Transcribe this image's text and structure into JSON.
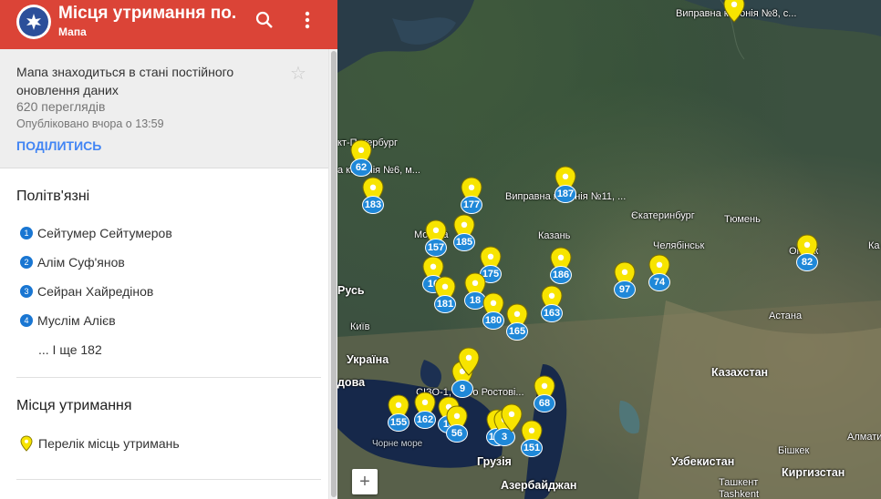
{
  "header": {
    "title": "Місця утримання по...",
    "subtitle": "Мапа"
  },
  "info": {
    "description": "Мапа знаходиться в стані постійного оновлення даних",
    "views": "620 переглядів",
    "published": "Опубліковано вчора о 13:59",
    "share_label": "ПОДІЛИТИСЬ"
  },
  "prisoners": {
    "title": "Політв'язні",
    "items": [
      {
        "num": "1",
        "name": "Сейтумер Сейтумеров"
      },
      {
        "num": "2",
        "name": "Алім Суф'янов"
      },
      {
        "num": "3",
        "name": "Сейран Хайредінов"
      },
      {
        "num": "4",
        "name": "Муслім Алієв"
      }
    ],
    "more": "... І ще 182"
  },
  "places": {
    "title": "Місця утримання",
    "item": "Перелік місць утримань"
  },
  "map": {
    "zoom_in": "+",
    "labels": [
      "Виправна колонія №8, с...",
      "кт-Петербург",
      "а колонія №6, м...",
      "Виправна колонія №11, ...",
      "Москва",
      "Казань",
      "Єкатеринбург",
      "Тюмень",
      "Челябінськ",
      "Омськ",
      "Астана",
      "Русь",
      "Київ",
      "Україна",
      "дова",
      "СІЗО-1, місто Ростові...",
      "Казахстан",
      "Чорне море",
      "Грузія",
      "Азербайджан",
      "Узбекистан",
      "Бішкек",
      "Алмати",
      "Ташкент",
      "Tashkent",
      "Киргизстан",
      "Ка"
    ],
    "pins": [
      {
        "count": "",
        "kind": "pin"
      },
      {
        "count": "62",
        "kind": "pin"
      },
      {
        "count": "183",
        "kind": "pin"
      },
      {
        "count": "177",
        "kind": "pin"
      },
      {
        "count": "187",
        "kind": "pin"
      },
      {
        "count": "157",
        "kind": "pin"
      },
      {
        "count": "185",
        "kind": "pin"
      },
      {
        "count": "175",
        "kind": "pin"
      },
      {
        "count": "186",
        "kind": "pin"
      },
      {
        "count": "97",
        "kind": "pin"
      },
      {
        "count": "74",
        "kind": "pin"
      },
      {
        "count": "82",
        "kind": "pin"
      },
      {
        "count": "16",
        "kind": "pin"
      },
      {
        "count": "181",
        "kind": "pin"
      },
      {
        "count": "18",
        "kind": "pin"
      },
      {
        "count": "180",
        "kind": "pin"
      },
      {
        "count": "165",
        "kind": "pin"
      },
      {
        "count": "163",
        "kind": "pin"
      },
      {
        "count": "9",
        "kind": "pin"
      },
      {
        "count": "68",
        "kind": "pin"
      },
      {
        "count": "155",
        "kind": "pin"
      },
      {
        "count": "162",
        "kind": "pin"
      },
      {
        "count": "18",
        "kind": "pin"
      },
      {
        "count": "56",
        "kind": "pin"
      },
      {
        "count": "161",
        "kind": "pin"
      },
      {
        "count": "3",
        "kind": "pin"
      },
      {
        "count": "151",
        "kind": "pin"
      },
      {
        "count": "",
        "kind": "pin"
      },
      {
        "count": "",
        "kind": "pin"
      }
    ]
  },
  "colors": {
    "header": "#db4437",
    "accent": "#4285f4",
    "pin": "#f7e400",
    "count_badge": "#1f88d8"
  }
}
